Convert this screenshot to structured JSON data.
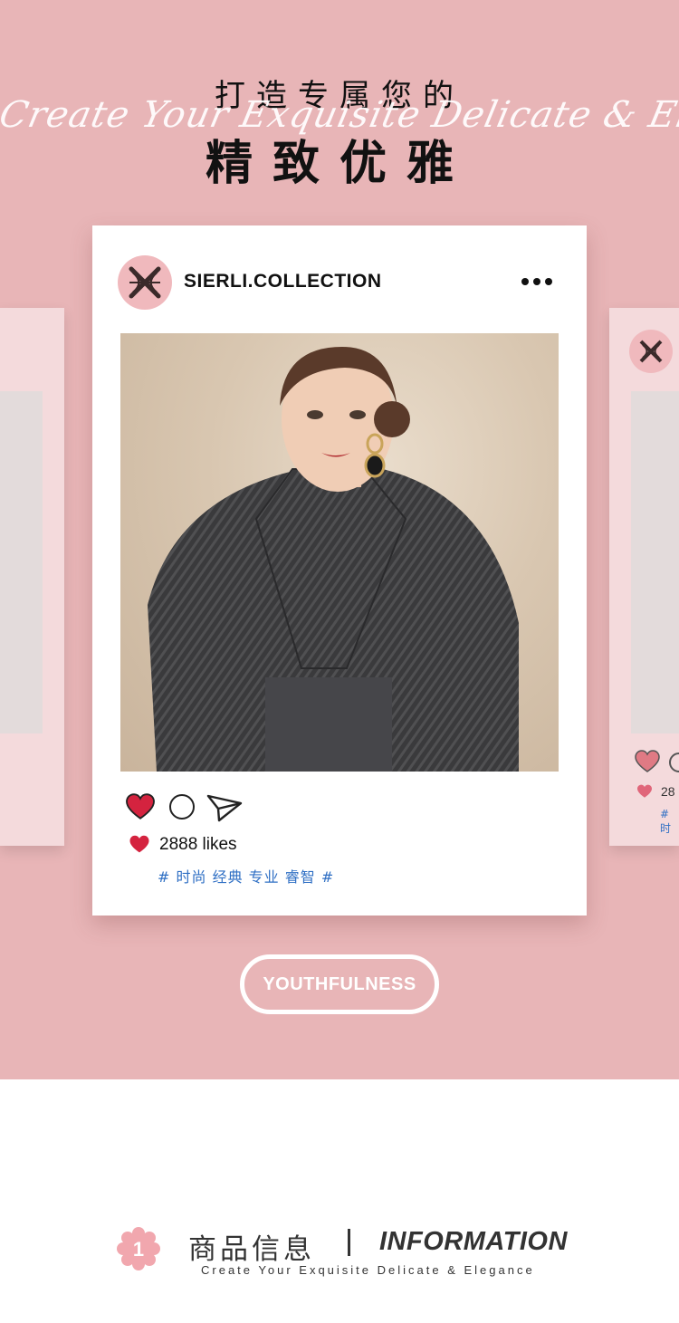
{
  "hero": {
    "title_line1": "打造专属您的",
    "title_script": "Create Your Exquisite Delicate & Elegance",
    "title_line2": "精致优雅"
  },
  "post": {
    "account_name": "SIERLI.COLLECTION",
    "avatar_icon": "brand-monogram-icon",
    "more_icon": "more-dots-icon",
    "actions": [
      "heart-icon",
      "comment-icon",
      "share-icon"
    ],
    "likes_text": "2888 likes",
    "hashtags": "# 时尚 经典 专业 睿智 #"
  },
  "side_card_right": {
    "likes_text": "28",
    "hashtag_fragment": "# 时"
  },
  "button": {
    "label": "YOUTHFULNESS"
  },
  "info": {
    "badge_number": "1",
    "title_cn": "商品信息",
    "title_en": "INFORMATION",
    "subtitle": "Create Your Exquisite Delicate & Elegance"
  },
  "colors": {
    "hero_bg": "#e8b5b7",
    "avatar_bg": "#f0b9bd",
    "heart_red": "#d4233f",
    "hashtag_blue": "#2f6fc4",
    "side_card_bg": "#f4dadc"
  }
}
